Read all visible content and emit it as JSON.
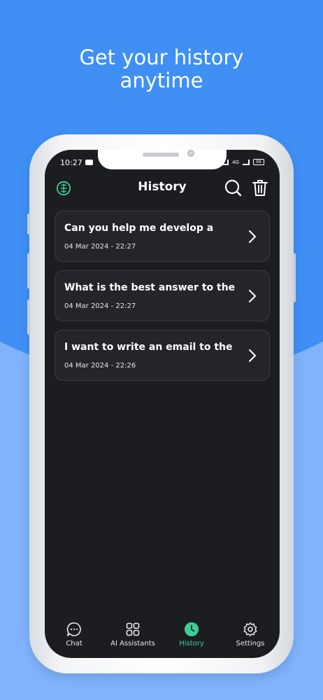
{
  "promo": {
    "headline_line1": "Get your history",
    "headline_line2": "anytime"
  },
  "status_bar": {
    "time": "10:27",
    "network": "4G",
    "battery": "99"
  },
  "app_bar": {
    "title": "History",
    "logo_icon": "brain-icon",
    "search_icon": "search-icon",
    "delete_icon": "trash-icon"
  },
  "history": [
    {
      "title": "Can you help me develop a",
      "date": "04 Mar 2024 - 22:27"
    },
    {
      "title": "What is the best answer to the",
      "date": "04 Mar 2024 - 22:27"
    },
    {
      "title": "I want to write an email to the",
      "date": "04 Mar 2024 - 22:26"
    }
  ],
  "bottom_nav": [
    {
      "label": "Chat",
      "icon": "chat-bubble-icon"
    },
    {
      "label": "AI Assistants",
      "icon": "grid-icon"
    },
    {
      "label": "History",
      "icon": "clock-icon",
      "active": true
    },
    {
      "label": "Settings",
      "icon": "gear-icon"
    }
  ],
  "colors": {
    "background_top": "#3f8ff5",
    "background_bottom": "#7fb3fb",
    "screen": "#1c1d21",
    "card": "#23252a",
    "accent": "#3fcf95"
  }
}
